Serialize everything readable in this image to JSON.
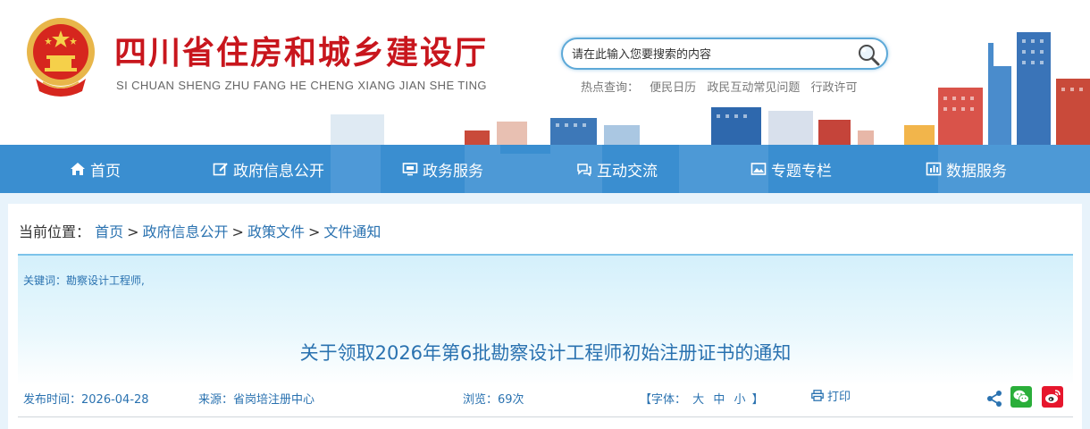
{
  "header": {
    "title": "四川省住房和城乡建设厅",
    "pinyin": "SI CHUAN SHENG ZHU FANG HE CHENG XIANG JIAN SHE TING"
  },
  "search": {
    "placeholder": "请在此输入您要搜索的内容",
    "hot_label": "热点查询：",
    "hot_links": [
      "便民日历",
      "政民互动常见问题",
      "行政许可"
    ]
  },
  "nav": {
    "items": [
      {
        "label": "首页",
        "icon": "home-icon"
      },
      {
        "label": "政府信息公开",
        "icon": "edit-icon"
      },
      {
        "label": "政务服务",
        "icon": "monitor-icon"
      },
      {
        "label": "互动交流",
        "icon": "chat-icon"
      },
      {
        "label": "专题专栏",
        "icon": "image-icon"
      },
      {
        "label": "数据服务",
        "icon": "chart-icon"
      }
    ]
  },
  "breadcrumb": {
    "label": "当前位置：",
    "items": [
      "首页",
      "政府信息公开",
      "政策文件",
      "文件通知"
    ],
    "separator": ">"
  },
  "article": {
    "keywords": "关键词：勘察设计工程师,",
    "title": "关于领取2026年第6批勘察设计工程师初始注册证书的通知",
    "publish_time": "发布时间：2026-04-28",
    "source": "来源：省岗培注册中心",
    "views": "浏览：69次",
    "font_label": "【字体：",
    "font_sizes": [
      "大",
      "中",
      "小"
    ],
    "font_close": "】",
    "print": "打印"
  },
  "colors": {
    "brand_red": "#c8161d",
    "nav_blue": "#3a8ed0",
    "link_blue": "#2a72b0",
    "wechat_green": "#2aae3a",
    "weibo_red": "#e6162d"
  }
}
